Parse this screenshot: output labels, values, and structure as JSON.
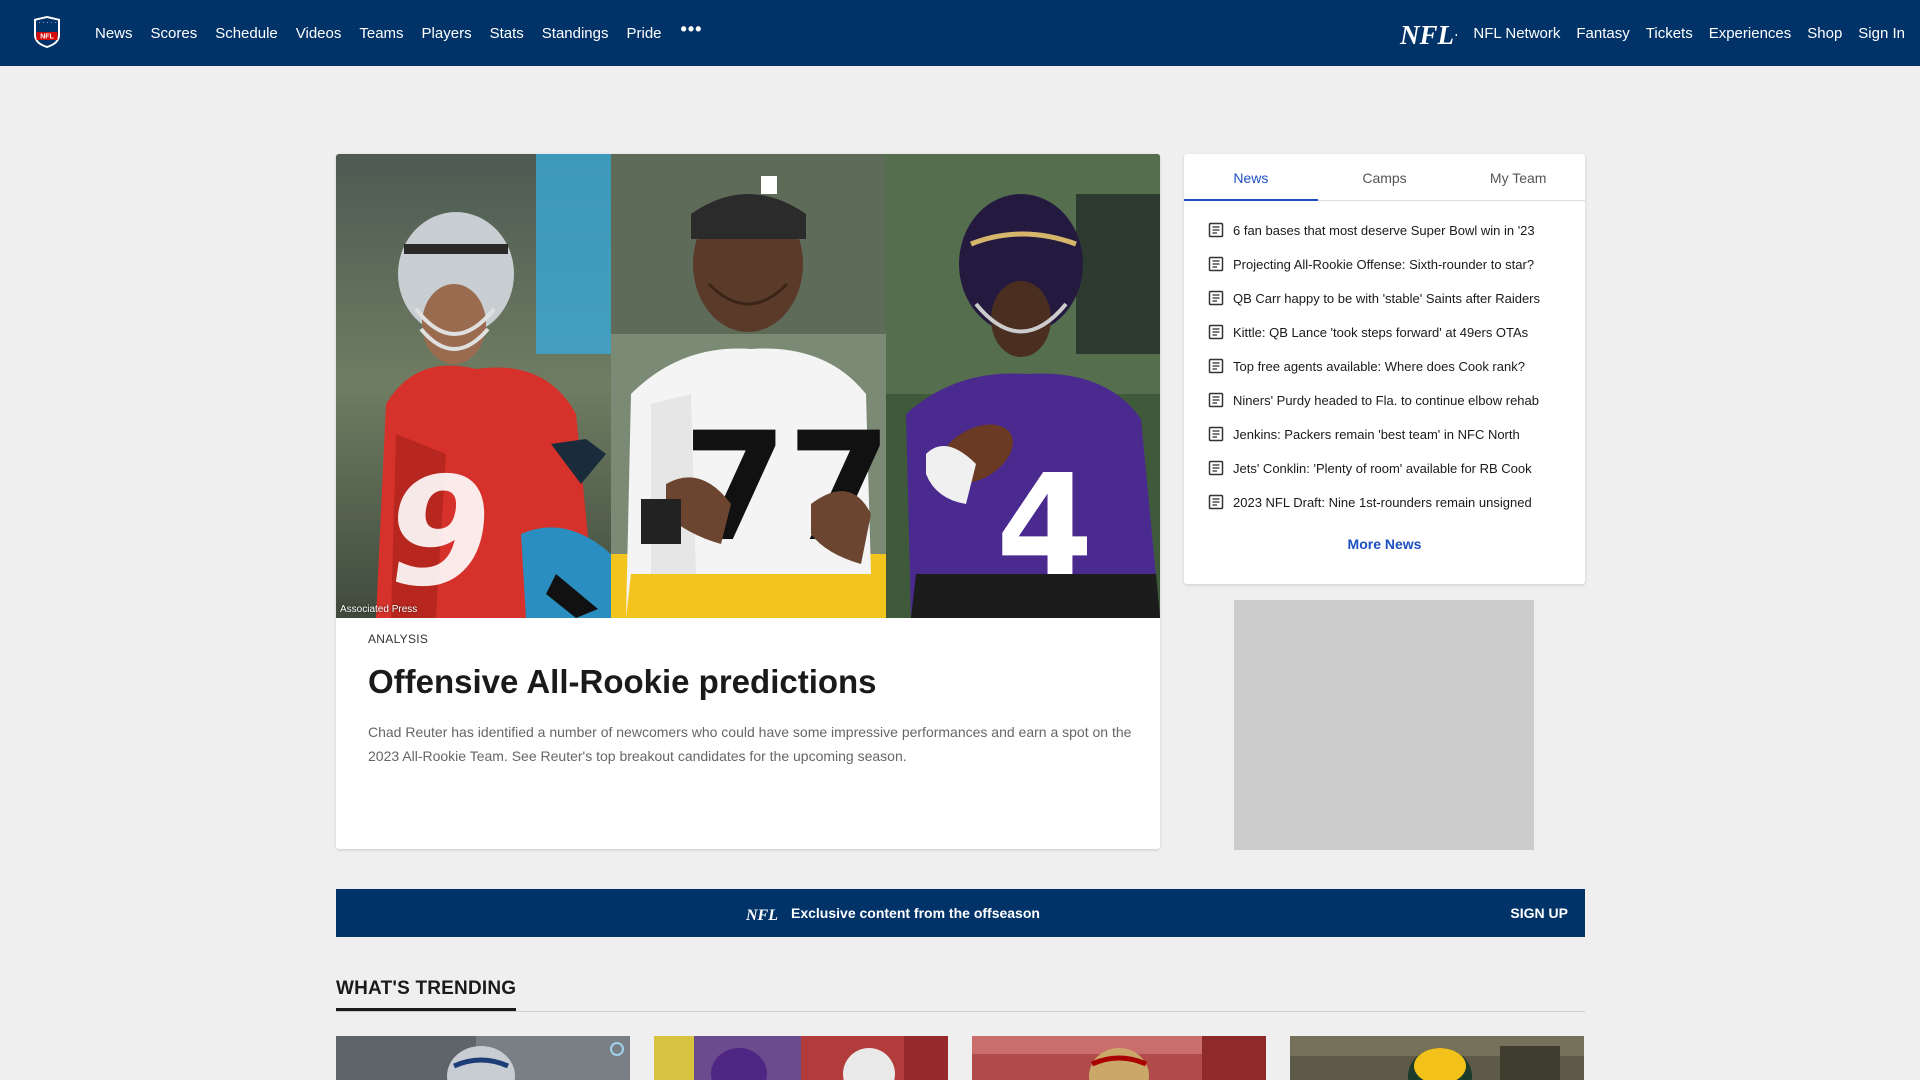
{
  "nav": {
    "logo_icon": "nfl-shield-icon",
    "left_items": [
      "News",
      "Scores",
      "Schedule",
      "Videos",
      "Teams",
      "Players",
      "Stats",
      "Standings",
      "Pride"
    ],
    "more_label": "•••",
    "plus_logo_text": "NFL+",
    "right_items": [
      "NFL Network",
      "Fantasy",
      "Tickets",
      "Experiences",
      "Shop",
      "Sign In"
    ]
  },
  "hero": {
    "photo_credit": "Associated Press",
    "kicker": "ANALYSIS",
    "title": "Offensive All-Rookie predictions",
    "description": "Chad Reuter has identified a number of newcomers who could have some impressive performances and earn a spot on the 2023 All-Rookie Team. See Reuter's top breakout candidates for the upcoming season.",
    "jersey_numbers": [
      "9",
      "77",
      "4"
    ]
  },
  "sidebar": {
    "tabs": [
      "News",
      "Camps",
      "My Team"
    ],
    "active_tab": "News",
    "headlines": [
      "6 fan bases that most deserve Super Bowl win in '23",
      "Projecting All-Rookie Offense: Sixth-rounder to star?",
      "QB Carr happy to be with 'stable' Saints after Raiders",
      "Kittle: QB Lance 'took steps forward' at 49ers OTAs",
      "Top free agents available: Where does Cook rank?",
      "Niners' Purdy headed to Fla. to continue elbow rehab",
      "Jenkins: Packers remain 'best team' in NFC North",
      "Jets' Conklin: 'Plenty of room' available for RB Cook",
      "2023 NFL Draft: Nine 1st-rounders remain unsigned"
    ],
    "more_label": "More News"
  },
  "promo": {
    "logo_text": "NFL+",
    "text": "Exclusive content from the offseason",
    "cta": "SIGN UP"
  },
  "trending": {
    "title": "WHAT'S TRENDING"
  },
  "colors": {
    "nav_bg": "#013369",
    "accent": "#1d4fc4",
    "page_bg": "#efefef"
  }
}
